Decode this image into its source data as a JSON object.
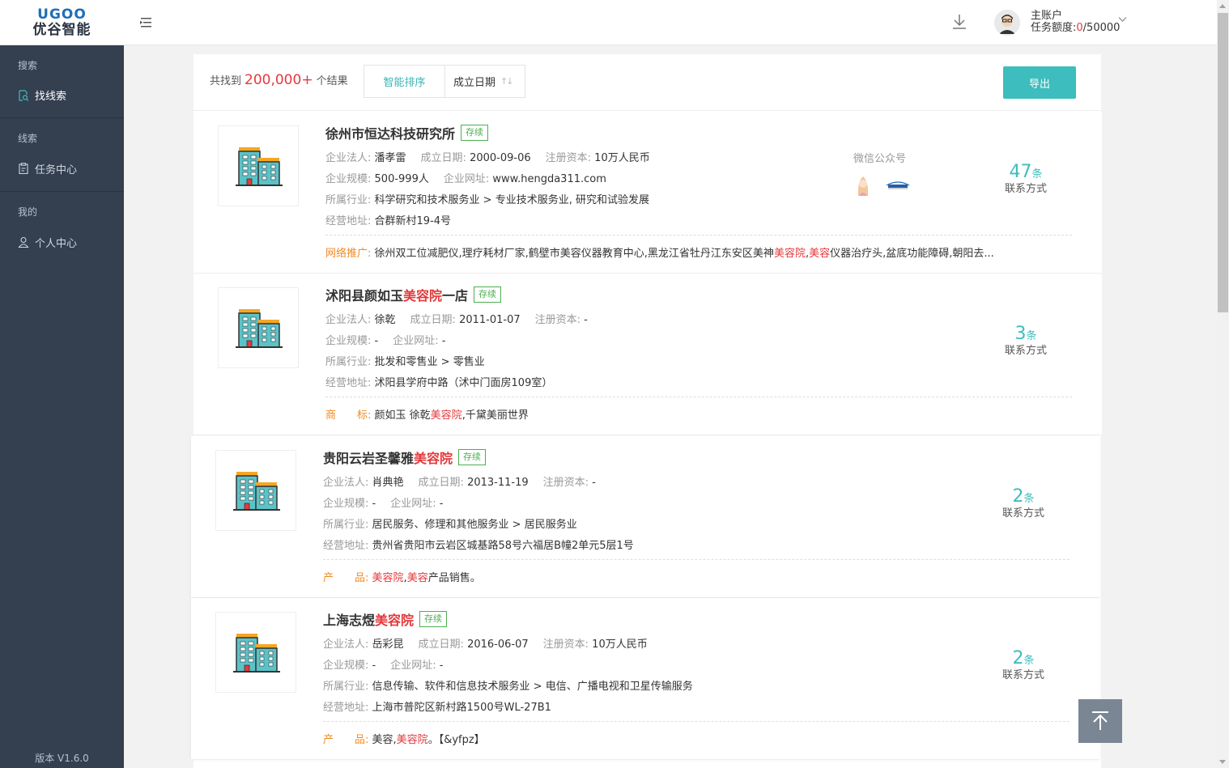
{
  "logo": {
    "line1": "UGOO",
    "line2": "优谷智能"
  },
  "header": {
    "account_name": "主账户",
    "quota_label": "任务额度:",
    "quota_used": "0",
    "quota_total": "/50000"
  },
  "sidebar": {
    "groups": [
      {
        "heading": "搜索",
        "items": [
          {
            "label": "找线索",
            "icon": "search-doc-icon",
            "active": true
          }
        ]
      },
      {
        "heading": "线索",
        "items": [
          {
            "label": "任务中心",
            "icon": "clipboard-icon",
            "active": false
          }
        ]
      },
      {
        "heading": "我的",
        "items": [
          {
            "label": "个人中心",
            "icon": "user-icon",
            "active": false
          }
        ]
      }
    ],
    "version": "版本 V1.6.0"
  },
  "results": {
    "prefix": "共找到",
    "count": "200,000+",
    "suffix": "个结果",
    "sort_smart": "智能排序",
    "sort_date": "成立日期",
    "export_label": "导出"
  },
  "labels": {
    "legal": "企业法人:",
    "founded": "成立日期:",
    "capital": "注册资本:",
    "scale": "企业规模:",
    "website": "企业网址:",
    "industry": "所属行业:",
    "address": "经营地址:",
    "contact_unit": "条",
    "contact_text": "联系方式",
    "wechat": "微信公众号"
  },
  "companies": [
    {
      "name_pre": "徐州市恒达科技研究所",
      "name_hl": "",
      "name_post": "",
      "status": "存续",
      "legal": "潘孝雷",
      "founded": "2000-09-06",
      "capital": "10万人民币",
      "scale": "500-999人",
      "website": "www.hengda311.com",
      "industry": "科学研究和技术服务业 > 专业技术服务业, 研究和试验发展",
      "address": "合群新村19-4号",
      "extra_label": "网络推广:",
      "extra_a": "徐州双工位减肥仪,理疗耗材厂家,鹤壁市美容仪器教育中心,黑龙江省牡丹江东安区美神",
      "extra_hl1": "美容院",
      "extra_b": ",",
      "extra_hl2": "美容",
      "extra_c": "仪器治疗头,盆底功能障碍,朝阳去...",
      "contacts": "47"
    },
    {
      "name_pre": "沭阳县颜如玉",
      "name_hl": "美容院",
      "name_post": "一店",
      "status": "存续",
      "legal": "徐乾",
      "founded": "2011-01-07",
      "capital": "-",
      "scale": "-",
      "website": "-",
      "industry": "批发和零售业 > 零售业",
      "address": "沭阳县学府中路（沭中门面房109室）",
      "extra_label": "商　　标:",
      "extra_a": "颜如玉 徐乾",
      "extra_hl1": "美容院",
      "extra_b": ",千黛美丽世界",
      "extra_hl2": "",
      "extra_c": "",
      "contacts": "3"
    },
    {
      "name_pre": "贵阳云岩圣馨雅",
      "name_hl": "美容院",
      "name_post": "",
      "status": "存续",
      "legal": "肖典艳",
      "founded": "2013-11-19",
      "capital": "-",
      "scale": "-",
      "website": "-",
      "industry": "居民服务、修理和其他服务业 > 居民服务业",
      "address": "贵州省贵阳市云岩区城基路58号六福居B幢2单元5层1号",
      "extra_label": "产　　品:",
      "extra_a": "",
      "extra_hl1": "美容院",
      "extra_b": ",",
      "extra_hl2": "美容",
      "extra_c": "产品销售。",
      "contacts": "2"
    },
    {
      "name_pre": "上海志煜",
      "name_hl": "美容院",
      "name_post": "",
      "status": "存续",
      "legal": "岳彩昆",
      "founded": "2016-06-07",
      "capital": "10万人民币",
      "scale": "-",
      "website": "-",
      "industry": "信息传输、软件和信息技术服务业 > 电信、广播电视和卫星传输服务",
      "address": "上海市普陀区新村路1500号WL-27B1",
      "extra_label": "产　　品:",
      "extra_a": "美容,",
      "extra_hl1": "美容院",
      "extra_b": "。【&yfpz】",
      "extra_hl2": "",
      "extra_c": "",
      "contacts": "2"
    }
  ],
  "colors": {
    "accent": "#3dbdbd",
    "highlight": "#e4393c",
    "label_orange": "#f08a24",
    "sidebar": "#343f50"
  }
}
